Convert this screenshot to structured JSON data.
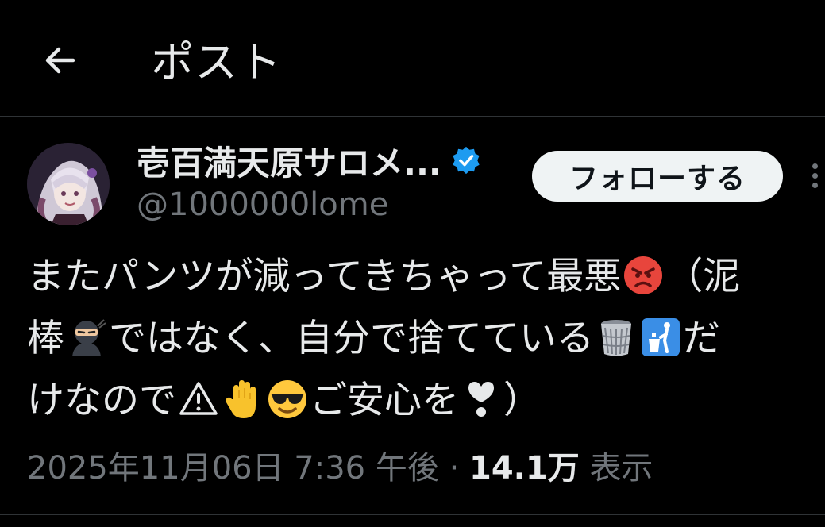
{
  "header": {
    "title": "ポスト",
    "back_icon": "arrow-left-icon"
  },
  "author": {
    "display_name": "壱百満天原サロメ...",
    "handle": "@1000000lome",
    "verified": true,
    "verified_color": "#1d9bf0"
  },
  "follow_button": {
    "label": "フォローする"
  },
  "tweet": {
    "segments_line1": {
      "text_a": "またパンツが減ってきちゃって最悪",
      "emoji_a": "angry-face-emoji",
      "text_b": "（泥"
    },
    "segments_line2": {
      "text_a": "棒",
      "emoji_a": "ninja-emoji",
      "text_b": "ではなく、自分で捨てている",
      "emoji_b": "wastebasket-emoji",
      "emoji_c": "litter-in-bin-sign-emoji",
      "text_c": "だ"
    },
    "segments_line3": {
      "text_a": "けなので",
      "emoji_a": "warning-emoji",
      "emoji_b": "raised-hand-emoji",
      "emoji_c": "smiling-face-with-sunglasses-emoji",
      "text_b": "ご安心を",
      "emoji_d": "heart-exclamation-emoji",
      "text_c": "）"
    }
  },
  "meta": {
    "timestamp": "2025年11月06日 7:36 午後",
    "separator": "·",
    "views_count": "14.1万",
    "views_label": "表示"
  },
  "colors": {
    "background": "#000000",
    "text_primary": "#e7e9ea",
    "text_secondary": "#71767b",
    "divider": "#2f3336",
    "follow_bg": "#eff3f4"
  }
}
